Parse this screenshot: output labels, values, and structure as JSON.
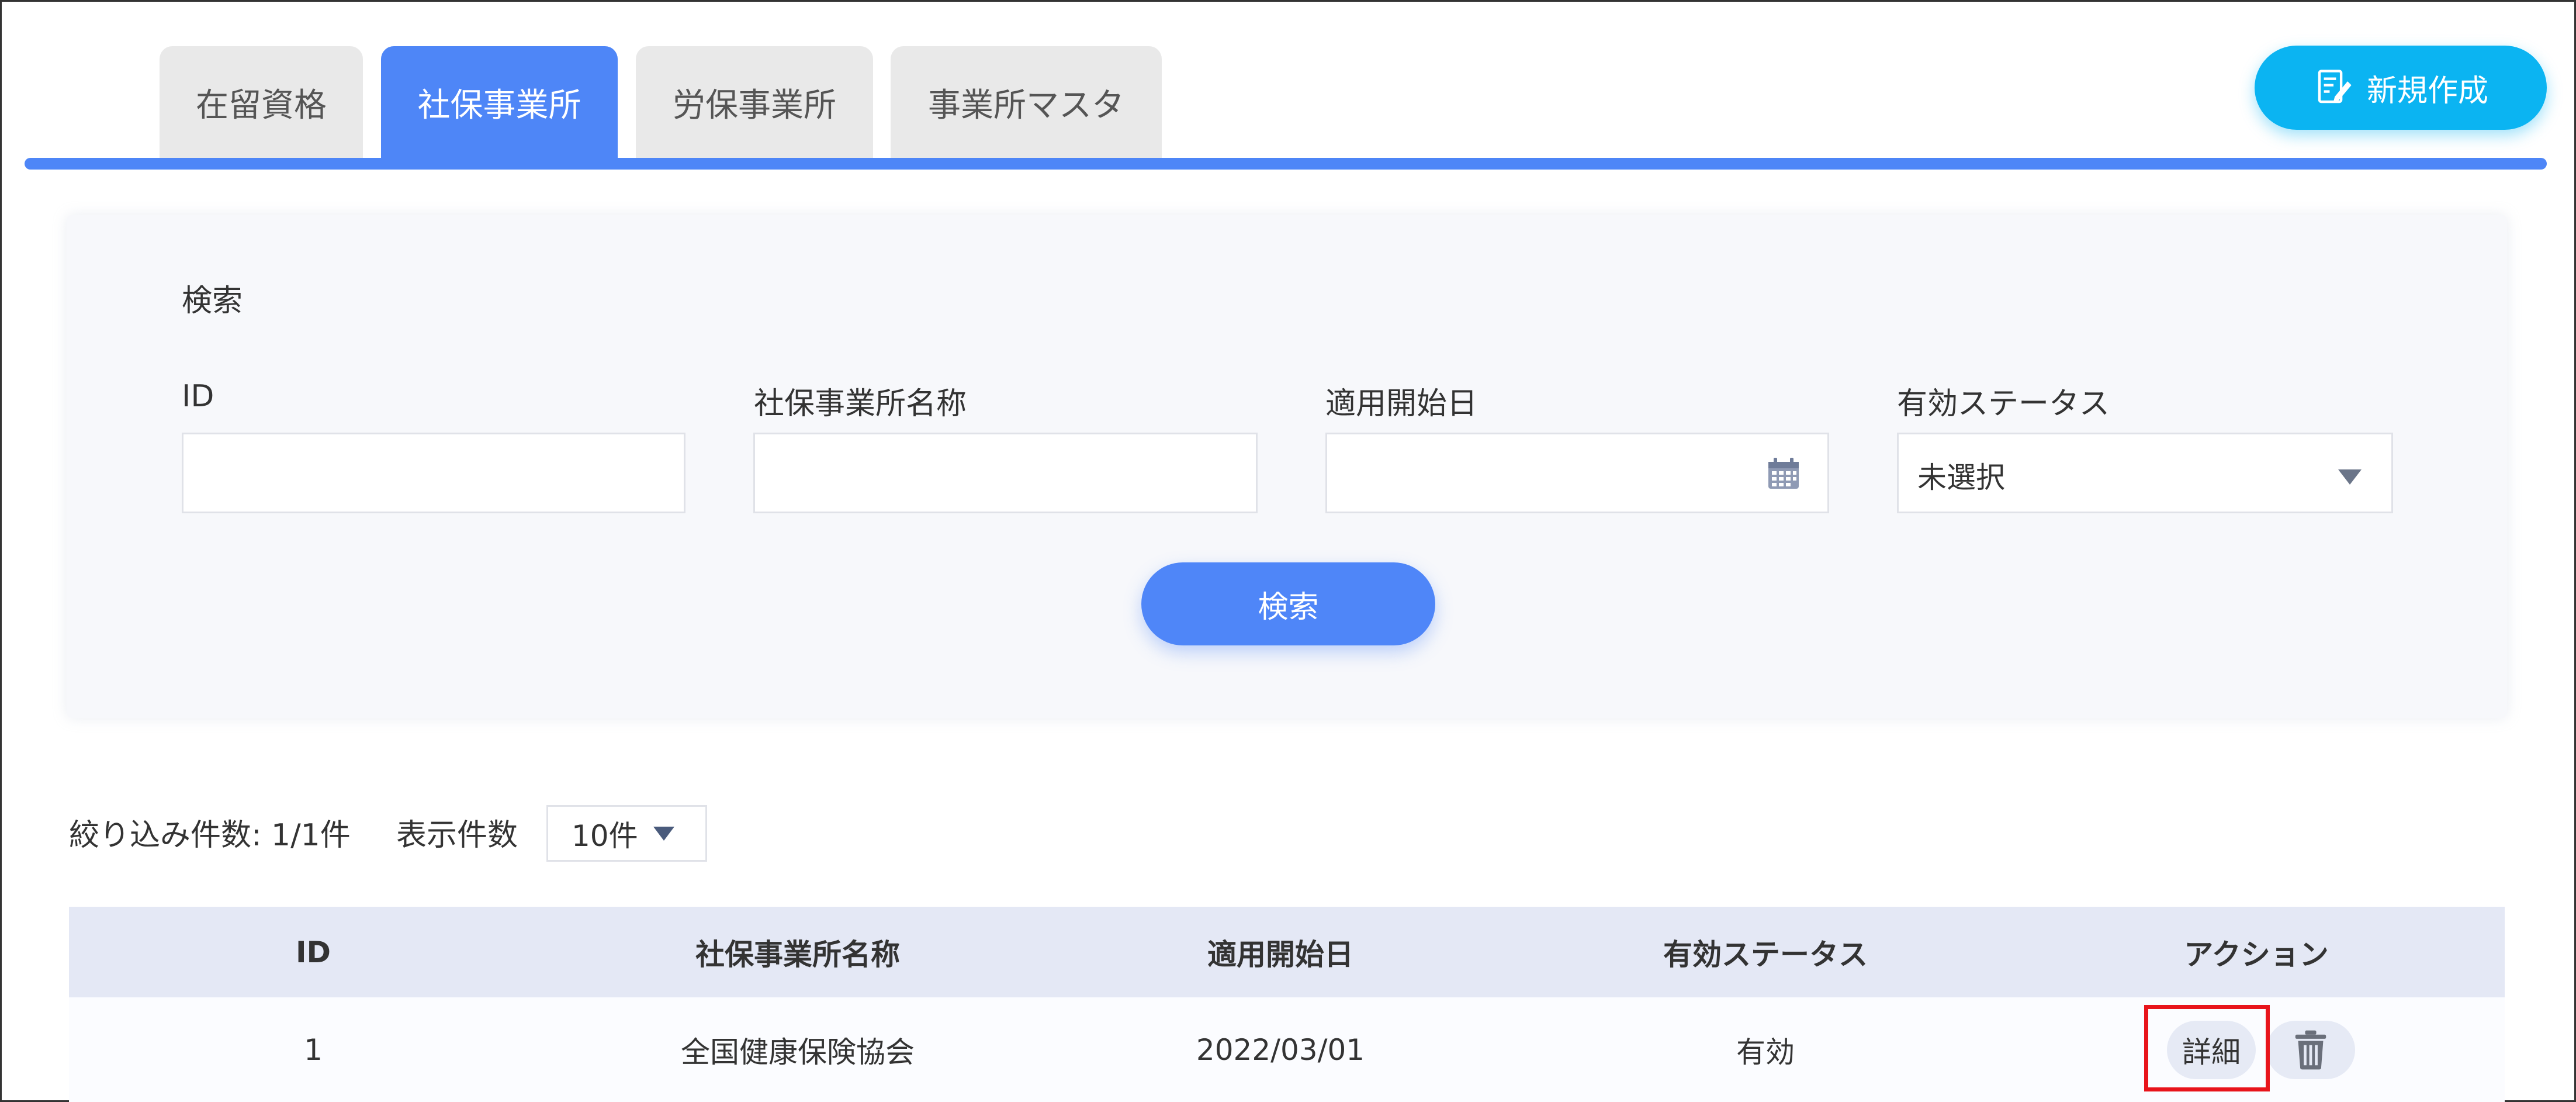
{
  "tabs": [
    {
      "label": "在留資格",
      "active": false
    },
    {
      "label": "社保事業所",
      "active": true
    },
    {
      "label": "労保事業所",
      "active": false
    },
    {
      "label": "事業所マスタ",
      "active": false
    }
  ],
  "new_button": {
    "label": "新規作成",
    "icon": "edit-document-icon"
  },
  "search": {
    "title": "検索",
    "fields": {
      "id": {
        "label": "ID",
        "value": ""
      },
      "name": {
        "label": "社保事業所名称",
        "value": ""
      },
      "start_date": {
        "label": "適用開始日",
        "value": "",
        "icon": "calendar-icon"
      },
      "status": {
        "label": "有効ステータス",
        "selected": "未選択"
      }
    },
    "button_label": "検索"
  },
  "filter": {
    "count_label": "絞り込み件数: 1/1件",
    "per_page_label": "表示件数",
    "per_page_value": "10件"
  },
  "table": {
    "headers": [
      "ID",
      "社保事業所名称",
      "適用開始日",
      "有効ステータス",
      "アクション"
    ],
    "rows": [
      {
        "id": "1",
        "name": "全国健康保険協会",
        "start_date": "2022/03/01",
        "status": "有効",
        "detail_label": "詳細"
      }
    ]
  },
  "colors": {
    "tab_active": "#4e86f7",
    "new_button": "#0bb4f2",
    "search_button": "#4f86f8",
    "table_header": "#e4e8f5",
    "highlight_border": "#e8141b"
  }
}
